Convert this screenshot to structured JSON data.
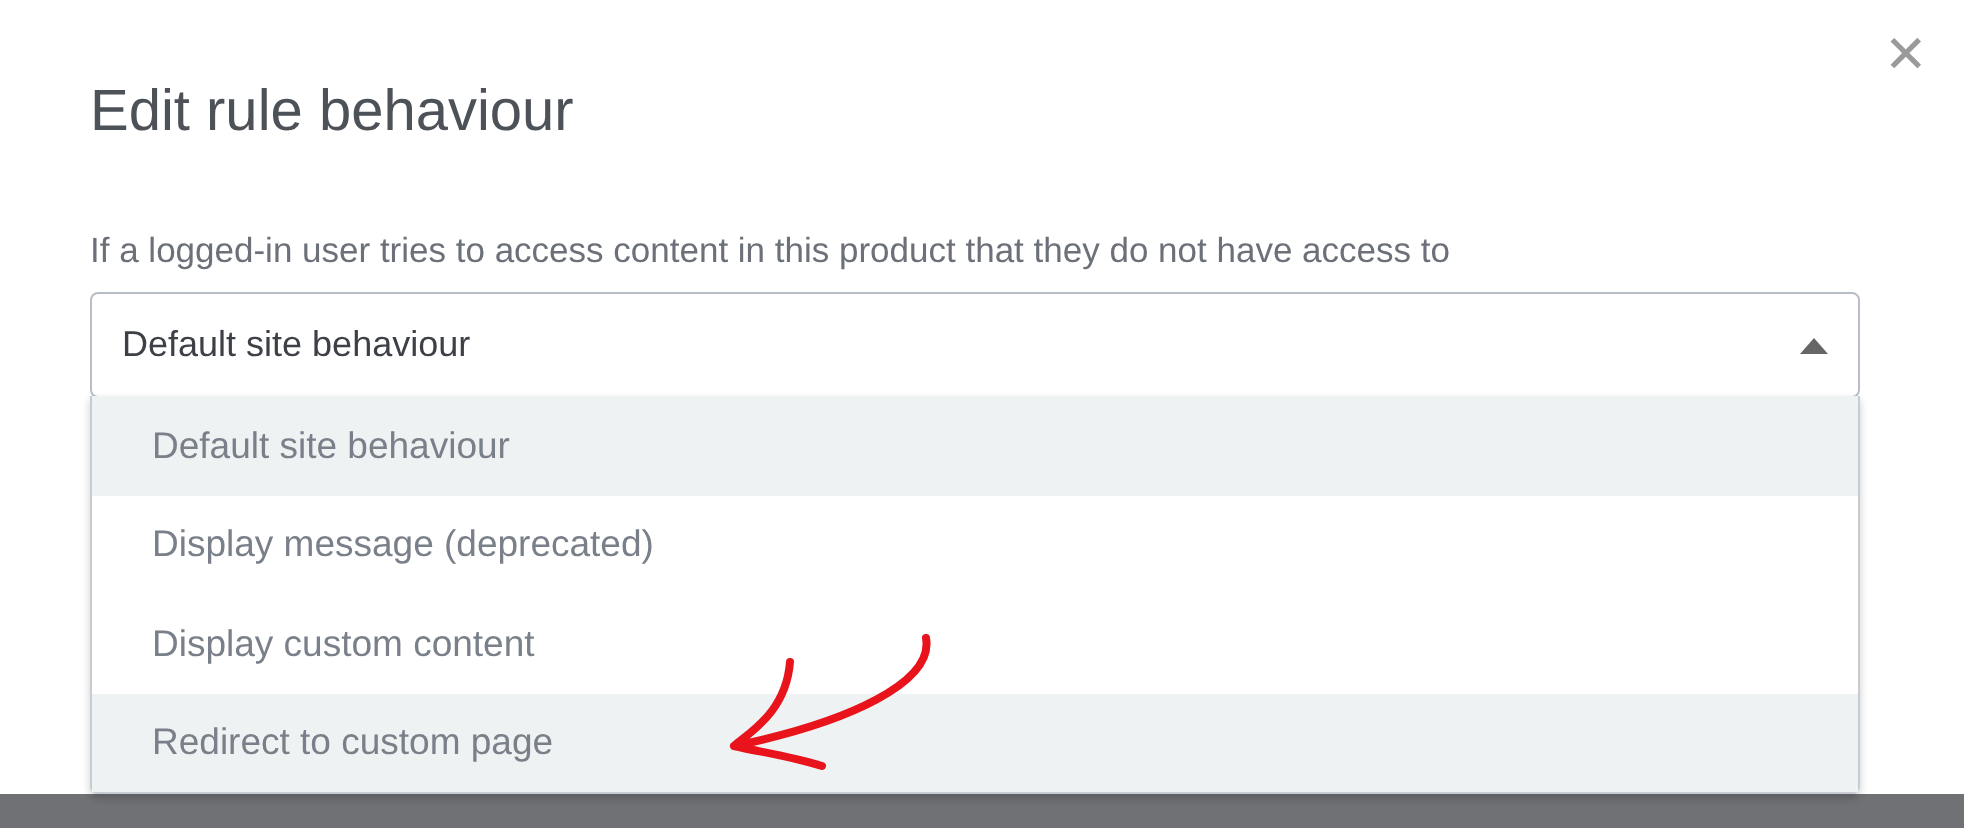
{
  "dialog": {
    "title": "Edit rule behaviour",
    "close": "✕"
  },
  "field": {
    "label": "If a logged-in user tries to access content in this product that they do not have access to",
    "value": "Default site behaviour",
    "expanded": true
  },
  "options": [
    {
      "label": "Default site behaviour",
      "highlighted": true
    },
    {
      "label": "Display message (deprecated)",
      "highlighted": false
    },
    {
      "label": "Display custom content",
      "highlighted": false
    },
    {
      "label": "Redirect to custom page",
      "highlighted": true
    }
  ]
}
